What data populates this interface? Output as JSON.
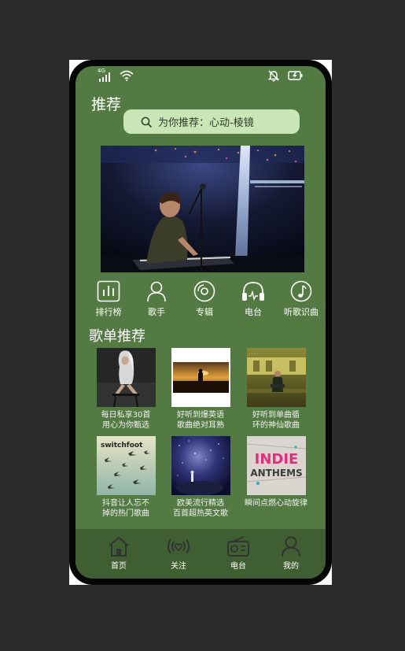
{
  "status_bar": {
    "network": "4G"
  },
  "header": {
    "title": "推荐"
  },
  "search": {
    "text": "为你推荐：心动-棱镜"
  },
  "categories": [
    {
      "label": "排行榜",
      "icon": "chart-icon"
    },
    {
      "label": "歌手",
      "icon": "person-icon"
    },
    {
      "label": "专辑",
      "icon": "disc-icon"
    },
    {
      "label": "电台",
      "icon": "headphones-icon"
    },
    {
      "label": "听歌识曲",
      "icon": "music-note-icon"
    }
  ],
  "section": {
    "title": "歌单推荐"
  },
  "playlists": [
    {
      "line1": "每日私享30首",
      "line2": "用心为你甄选"
    },
    {
      "line1": "好听到爆英语",
      "line2": "歌曲绝对耳熟"
    },
    {
      "line1": "好听到单曲循",
      "line2": "环的神仙歌曲"
    },
    {
      "line1": "抖音让人忘不",
      "line2": "掉的热门歌曲"
    },
    {
      "line1": "欧美流行精选",
      "line2": "百首超热英文歌"
    },
    {
      "line1": "瞬间点燃心动旋律",
      "line2": ""
    }
  ],
  "album_art": {
    "switchfoot": "switchfoot",
    "indie_line1": "INDIE",
    "indie_line2": "ANTHEMS"
  },
  "tabbar": [
    {
      "label": "首页",
      "icon": "home-icon"
    },
    {
      "label": "关注",
      "icon": "radio-waves-icon"
    },
    {
      "label": "电台",
      "icon": "radio-icon"
    },
    {
      "label": "我的",
      "icon": "user-icon"
    }
  ],
  "colors": {
    "screen_bg": "#547a44",
    "search_bg": "#c9e7b6",
    "tabbar_bg": "#3f5e31"
  }
}
